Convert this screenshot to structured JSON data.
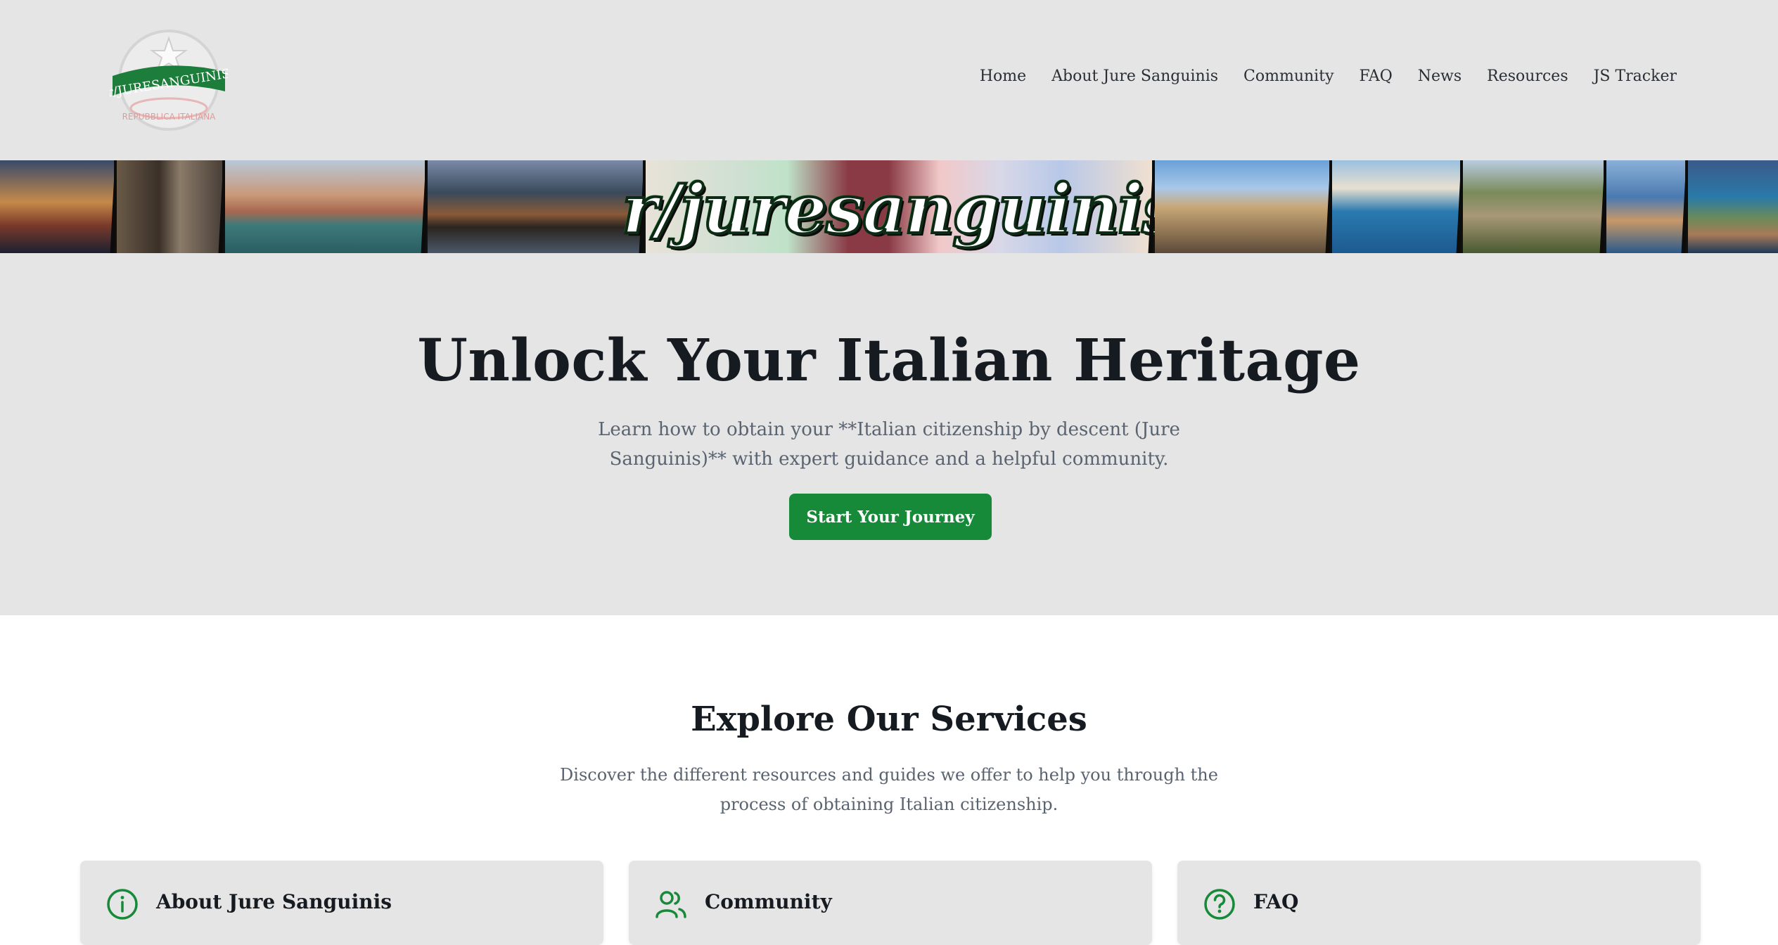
{
  "brand": {
    "logo_text": "r/JURESANGUINIS",
    "logo_subtext": "REPUBBLICA ITALIANA",
    "accent": "#178a39"
  },
  "nav": {
    "items": [
      {
        "label": "Home"
      },
      {
        "label": "About Jure Sanguinis"
      },
      {
        "label": "Community"
      },
      {
        "label": "FAQ"
      },
      {
        "label": "News"
      },
      {
        "label": "Resources"
      },
      {
        "label": "JS Tracker"
      }
    ]
  },
  "banner": {
    "title": "r/juresanguinis"
  },
  "hero": {
    "title": "Unlock Your Italian Heritage",
    "subtitle": "Learn how to obtain your **Italian citizenship by descent (Jure Sanguinis)** with expert guidance and a helpful community.",
    "cta_label": "Start Your Journey"
  },
  "services": {
    "title": "Explore Our Services",
    "description": "Discover the different resources and guides we offer to help you through the process of obtaining Italian citizenship.",
    "cards": [
      {
        "title": "About Jure Sanguinis",
        "icon": "info-icon"
      },
      {
        "title": "Community",
        "icon": "users-icon"
      },
      {
        "title": "FAQ",
        "icon": "question-icon"
      }
    ]
  }
}
